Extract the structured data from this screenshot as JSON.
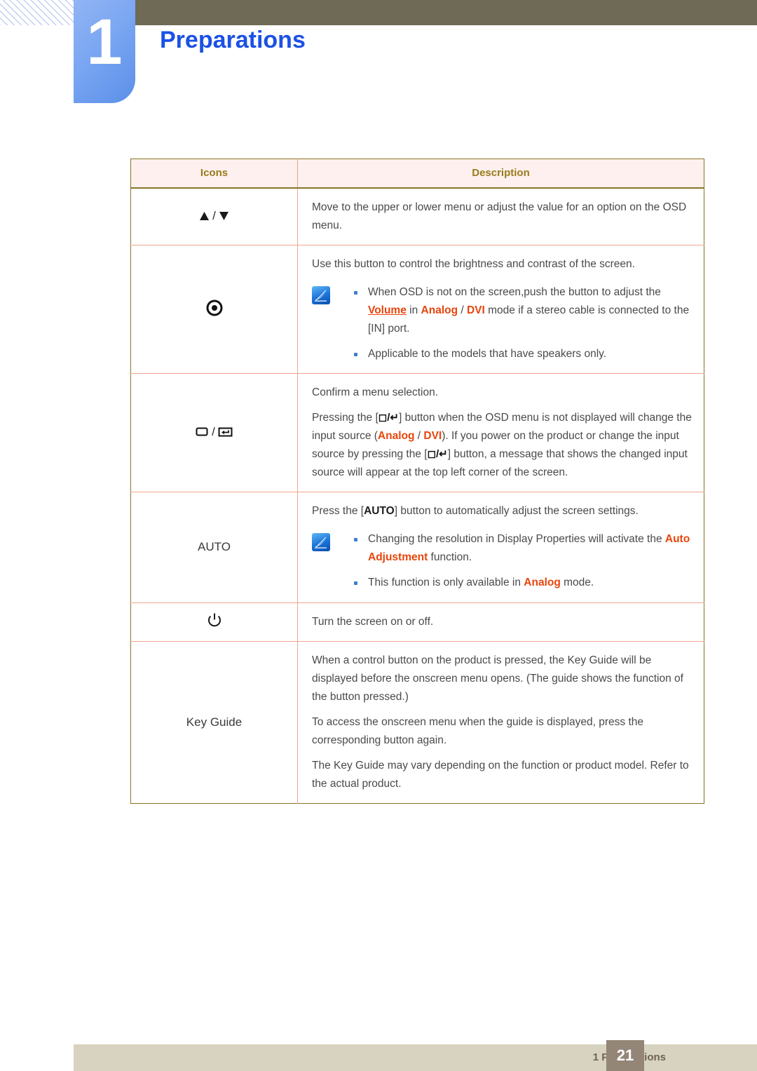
{
  "header": {
    "chapter_number": "1",
    "chapter_title": "Preparations"
  },
  "table": {
    "columns": [
      "Icons",
      "Description"
    ],
    "rows": [
      {
        "icon_label": "▲/▼",
        "icon_name": "up-down-triangle-icon",
        "paragraphs": [
          "Move to the upper or lower menu or adjust the value for an option on the OSD menu."
        ]
      },
      {
        "icon_label": "⊙",
        "icon_name": "brightness-contrast-icon",
        "lead": "Use this button to control the brightness and contrast of the screen.",
        "notes": [
          {
            "pre": "When OSD is not on the screen,push the button to adjust the ",
            "hl1": "Volume",
            "mid1": " in ",
            "hl2": "Analog",
            "mid2": " / ",
            "hl3": "DVI",
            "post": " mode if a stereo cable is connected to the [IN] port."
          },
          {
            "plain": "Applicable to the models that have speakers only."
          }
        ]
      },
      {
        "icon_label": "□/↵",
        "icon_name": "source-enter-icon",
        "paragraphs": [
          "Confirm a menu selection."
        ],
        "rich": {
          "p1": "Pressing the [",
          "p2": "] button when the OSD menu is not displayed will change the input source (",
          "hl_analog": "Analog",
          "p3": " / ",
          "hl_dvi": "DVI",
          "p4": "). If you power on the product or change the input source by pressing the [",
          "p5": "] button, a message that shows the changed input source will appear at the top left corner of the screen."
        }
      },
      {
        "icon_label": "AUTO",
        "icon_name": "auto-button-icon",
        "lead_pre": "Press the [",
        "lead_kbd": "AUTO",
        "lead_post": "] button to automatically adjust the screen settings.",
        "notes": [
          {
            "pre": "Changing the resolution in Display Properties will activate the ",
            "hl1": "Auto Adjustment",
            "post": " function."
          },
          {
            "pre": "This function is only available in ",
            "hl1": "Analog",
            "post": " mode."
          }
        ]
      },
      {
        "icon_label": "⏻",
        "icon_name": "power-icon",
        "paragraphs": [
          "Turn the screen on or off."
        ]
      },
      {
        "icon_label": "Key Guide",
        "icon_name": "key-guide-label",
        "paragraphs": [
          "When a control button on the product is pressed, the Key Guide will be displayed before the onscreen menu opens. (The guide shows the function of the button pressed.)",
          "To access the onscreen menu when the guide is displayed, press the corresponding button again.",
          "The Key Guide may vary depending on the function or product model. Refer to the actual product."
        ]
      }
    ]
  },
  "footer": {
    "text": "1 Preparations",
    "page_number": "21"
  },
  "colors": {
    "chapter_blue": "#1b51e5",
    "tab_blue": "#7aa6f2",
    "olive_bar": "#6f6a55",
    "table_border": "#8a7426",
    "row_divider": "#f0a58c",
    "header_bg": "#fdf0ee",
    "header_text": "#9a7b1b",
    "highlight_orange": "#e8450c",
    "footer_bar": "#d8d3c0",
    "page_box": "#938677"
  }
}
